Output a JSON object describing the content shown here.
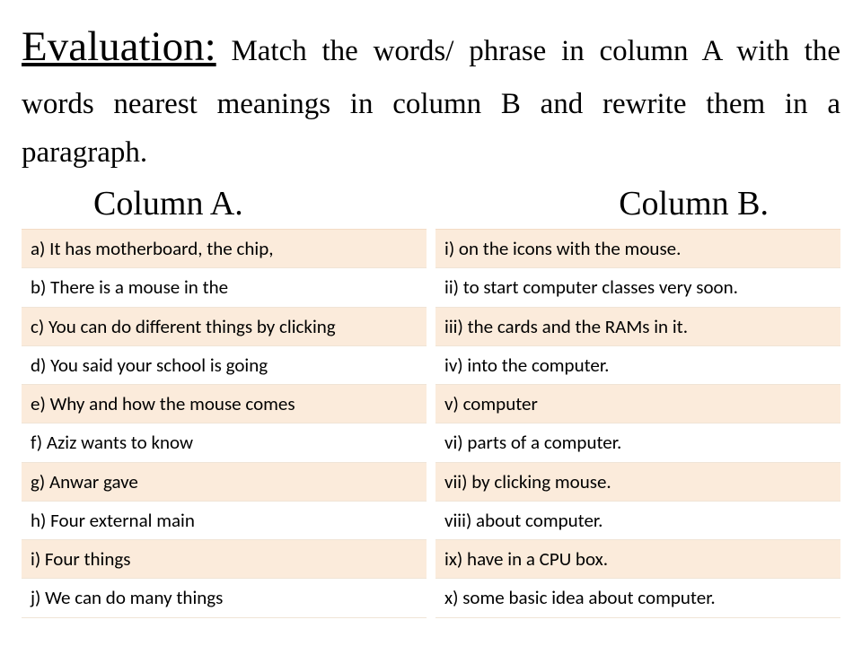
{
  "header": {
    "eval_label": "Evaluation:",
    "instruction_rest": " Match the words/ phrase in column A with the words nearest meanings in column B and rewrite them in a paragraph."
  },
  "columns": {
    "a_header": "Column A.",
    "b_header": "Column B.",
    "a_items": [
      "a) It has motherboard, the chip,",
      "b) There is a mouse in the",
      "c) You can do different things by clicking",
      "d) You said your school is going",
      "e) Why and how the mouse comes",
      "f) Aziz wants to know",
      "g) Anwar gave",
      "h) Four external main",
      "i) Four things",
      "j) We can do many things"
    ],
    "b_items": [
      "i) on the icons with the mouse.",
      "ii) to start computer classes very soon.",
      "iii) the cards and the RAMs in it.",
      "iv) into the computer.",
      "v) computer",
      "vi) parts of a computer.",
      "vii) by clicking mouse.",
      "viii) about computer.",
      "ix) have in a CPU box.",
      "x) some basic idea about computer."
    ]
  }
}
